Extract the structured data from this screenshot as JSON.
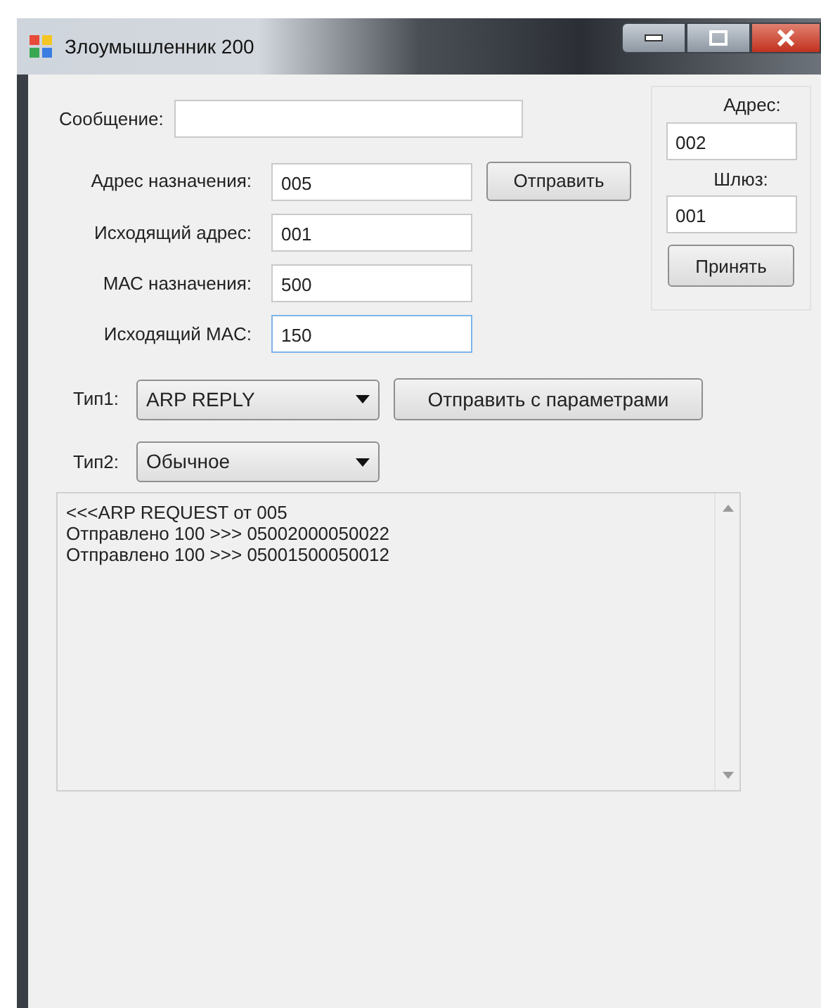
{
  "window": {
    "title": "Злоумышленник 200"
  },
  "message": {
    "label": "Сообщение:"
  },
  "address_fields": [
    {
      "label": "Адрес назначения:",
      "value": "005",
      "focused": false
    },
    {
      "label": "Исходящий адрес:",
      "value": "001",
      "focused": false
    },
    {
      "label": "МАС назначения:",
      "value": "500",
      "focused": false
    },
    {
      "label": "Исходящий MAC:",
      "value": "150",
      "focused": true
    }
  ],
  "send_button": "Отправить",
  "settings_panel": {
    "address_label": "Адрес:",
    "address": "002",
    "gateway_label": "Шлюз:",
    "gateway": "001",
    "apply_button": "Принять"
  },
  "type1": {
    "label": "Тип1:",
    "value": "ARP REPLY"
  },
  "send_with_params_button": "Отправить с параметрами",
  "type2": {
    "label": "Тип2:",
    "value": "Обычное"
  },
  "log": {
    "lines": [
      "<<<ARP REQUEST от 005",
      "Отправлено 100 >>> 05002000050022",
      "Отправлено 100 >>> 05001500050012"
    ]
  }
}
